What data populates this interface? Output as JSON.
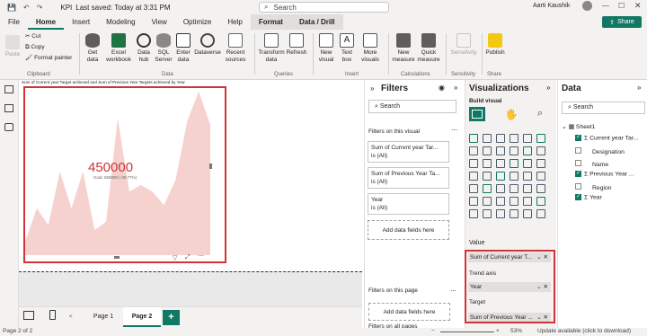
{
  "app": {
    "filename": "KPI",
    "saved": "Last saved: Today at 3:31 PM",
    "search": "Search",
    "user": "Aarti Kaushik",
    "share": "Share"
  },
  "menu": [
    "File",
    "Home",
    "Insert",
    "Modeling",
    "View",
    "Optimize",
    "Help",
    "Format",
    "Data / Drill"
  ],
  "ribbon": {
    "paste": "Paste",
    "cut": "Cut",
    "copy": "Copy",
    "format_painter": "Format painter",
    "clipboard": "Clipboard",
    "get_data": "Get data",
    "excel": "Excel workbook",
    "hub": "Data hub",
    "sql": "SQL Server",
    "enter": "Enter data",
    "dataverse": "Dataverse",
    "recent": "Recent sources",
    "data": "Data",
    "transform": "Transform data",
    "refresh": "Refresh",
    "queries": "Queries",
    "new_visual": "New visual",
    "text_box": "Text box",
    "more_visuals": "More visuals",
    "insert": "Insert",
    "new_measure": "New measure",
    "quick_measure": "Quick measure",
    "calculations": "Calculations",
    "sensitivity": "Sensitivity",
    "sens_group": "Sensitivity",
    "publish": "Publish",
    "share_group": "Share"
  },
  "visual": {
    "title": "Sum of Current year Target achieved and Sum of Previous Year Targets achieved by Year",
    "kpi_value": "450000",
    "goal": "Goal: 650000 (-30.77%)",
    "trend": [
      0.08,
      0.28,
      0.18,
      0.5,
      0.28,
      0.5,
      0.15,
      0.2,
      0.82,
      0.38,
      0.42,
      0.38,
      0.3,
      0.45,
      0.8,
      0.98,
      0.78
    ]
  },
  "filters": {
    "title": "Filters",
    "search": "Search",
    "on_visual": "Filters on this visual",
    "cards": [
      {
        "name": "Sum of Current year Tar...",
        "val": "is (All)"
      },
      {
        "name": "Sum of Previous Year Ta...",
        "val": "is (All)"
      },
      {
        "name": "Year",
        "val": "is (All)"
      }
    ],
    "add": "Add data fields here",
    "on_page": "Filters on this page",
    "on_all": "Filters on all pages"
  },
  "viz": {
    "title": "Visualizations",
    "build": "Build visual",
    "value_label": "Value",
    "value_field": "Sum of Current year T...",
    "trend_label": "Trend axis",
    "trend_field": "Year",
    "target_label": "Target",
    "target_field": "Sum of Previous Year ..."
  },
  "data": {
    "title": "Data",
    "search": "Search",
    "table": "Sheet1",
    "fields": [
      {
        "name": "Current year Tar...",
        "checked": true,
        "sigma": true
      },
      {
        "name": "Designation",
        "checked": false,
        "sigma": false
      },
      {
        "name": "Name",
        "checked": false,
        "sigma": false
      },
      {
        "name": "Previous Year ...",
        "checked": true,
        "sigma": true
      },
      {
        "name": "Region",
        "checked": false,
        "sigma": false
      },
      {
        "name": "Year",
        "checked": true,
        "sigma": true
      }
    ]
  },
  "pages": {
    "tabs": [
      "Page 1",
      "Page 2"
    ],
    "add": "+"
  },
  "status": {
    "page": "Page 2 of 2",
    "zoom": "53%",
    "update": "Update available (click to download)"
  }
}
